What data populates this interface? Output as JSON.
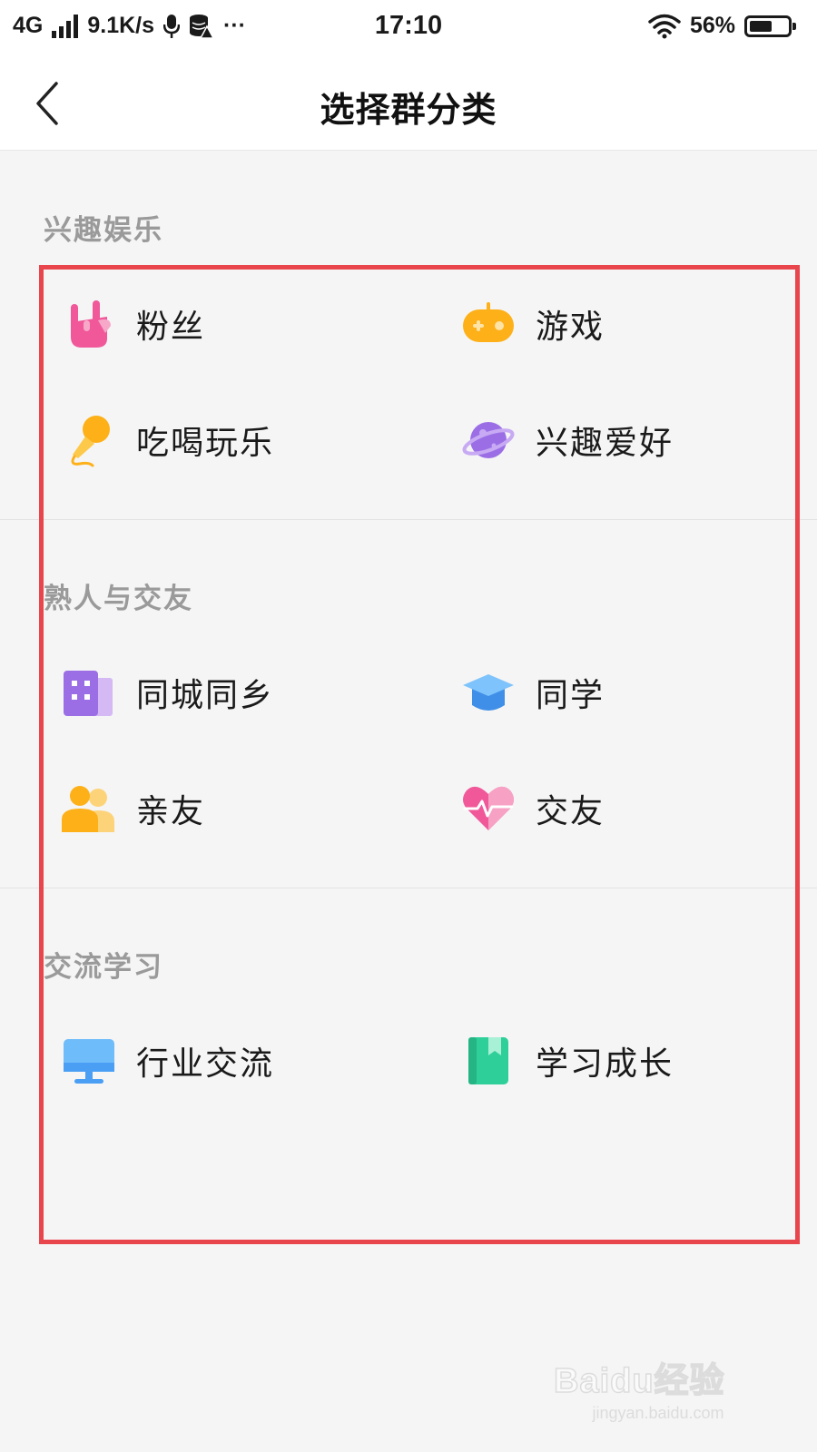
{
  "status_bar": {
    "network": "4G",
    "speed": "9.1K/s",
    "more": "···",
    "time": "17:10",
    "battery": "56%"
  },
  "nav": {
    "title": "选择群分类"
  },
  "sections": [
    {
      "title": "兴趣娱乐",
      "items": [
        {
          "label": "粉丝",
          "icon": "rock-hand-icon"
        },
        {
          "label": "游戏",
          "icon": "gamepad-icon"
        },
        {
          "label": "吃喝玩乐",
          "icon": "microphone-icon"
        },
        {
          "label": "兴趣爱好",
          "icon": "planet-icon"
        }
      ]
    },
    {
      "title": "熟人与交友",
      "items": [
        {
          "label": "同城同乡",
          "icon": "building-icon"
        },
        {
          "label": "同学",
          "icon": "graduation-cap-icon"
        },
        {
          "label": "亲友",
          "icon": "people-icon"
        },
        {
          "label": "交友",
          "icon": "heart-pulse-icon"
        }
      ]
    },
    {
      "title": "交流学习",
      "items": [
        {
          "label": "行业交流",
          "icon": "monitor-icon"
        },
        {
          "label": "学习成长",
          "icon": "book-icon"
        }
      ]
    }
  ],
  "watermark": {
    "brand": "Baidu经验",
    "url": "jingyan.baidu.com"
  },
  "colors": {
    "background": "#f5f5f5",
    "highlight": "#e8454c",
    "section_title": "#9a9a9a",
    "pink": "#f0589a",
    "orange": "#fdb018",
    "purple": "#9b6ee6",
    "blue": "#4a9ff5",
    "green": "#2fcf9a"
  }
}
